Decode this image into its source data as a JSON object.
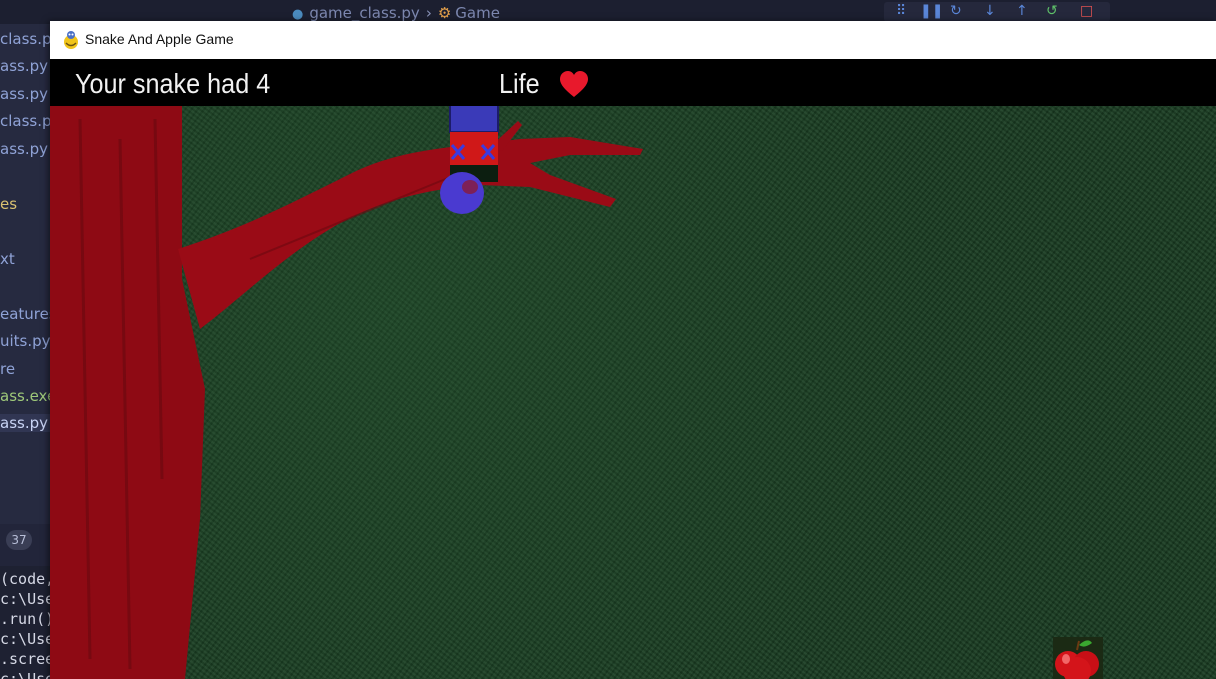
{
  "editor": {
    "breadcrumb_file": "game_class.py",
    "breadcrumb_symbol": "Game",
    "explorer_items": [
      "class.py",
      "ass.py",
      "ass.py",
      "class.py",
      "ass.py",
      "es",
      "xt",
      "eatures",
      "uits.py",
      "re",
      "ass.exe",
      "ass.py"
    ],
    "problems_count": "37",
    "terminal_lines": [
      "(code,",
      "c:\\Use",
      ".run()",
      "c:\\Use",
      ".scree",
      "c:\\Use"
    ]
  },
  "window": {
    "title": "Snake And Apple Game"
  },
  "hud": {
    "score_text": "Your snake had 4",
    "life_label": "Life"
  },
  "colors": {
    "tree": "#8e0a14",
    "snake_body": "#3a3ab8",
    "snake_head": "#d01818",
    "background": "#1a3d22",
    "heart": "#e8192c"
  }
}
